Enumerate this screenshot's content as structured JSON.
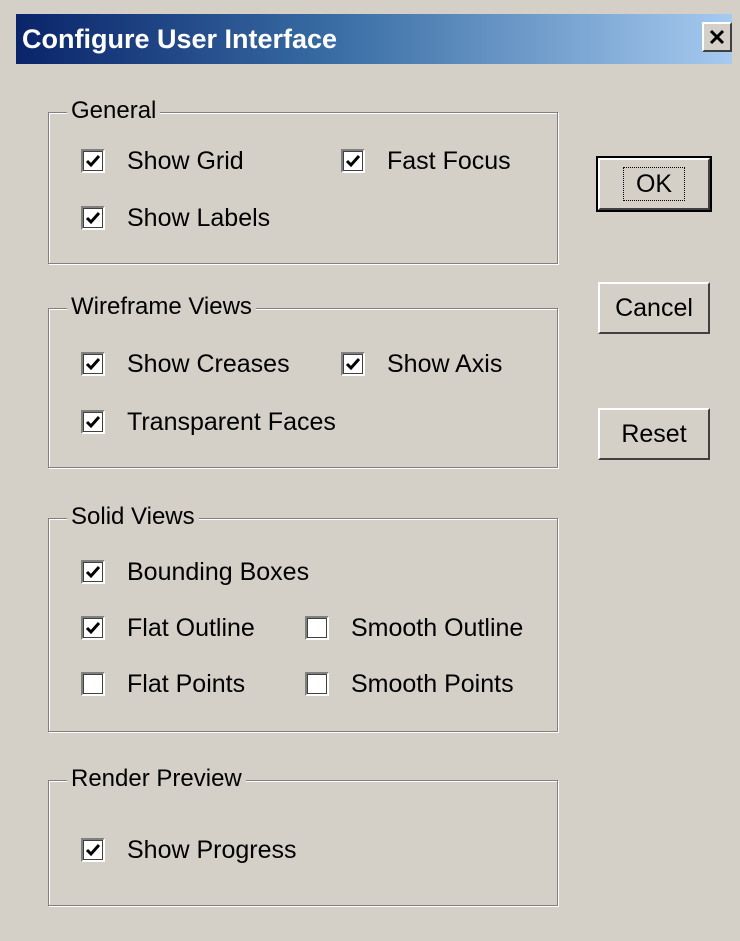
{
  "window": {
    "title": "Configure User Interface",
    "close_label": "close"
  },
  "groups": {
    "general": {
      "legend": "General",
      "show_grid": {
        "label": "Show Grid",
        "checked": true
      },
      "fast_focus": {
        "label": "Fast Focus",
        "checked": true
      },
      "show_labels": {
        "label": "Show Labels",
        "checked": true
      }
    },
    "wireframe": {
      "legend": "Wireframe Views",
      "show_creases": {
        "label": "Show Creases",
        "checked": true
      },
      "show_axis": {
        "label": "Show Axis",
        "checked": true
      },
      "transparent_faces": {
        "label": "Transparent Faces",
        "checked": true
      }
    },
    "solid": {
      "legend": "Solid Views",
      "bounding_boxes": {
        "label": "Bounding Boxes",
        "checked": true
      },
      "flat_outline": {
        "label": "Flat Outline",
        "checked": true
      },
      "smooth_outline": {
        "label": "Smooth Outline",
        "checked": false
      },
      "flat_points": {
        "label": "Flat Points",
        "checked": false
      },
      "smooth_points": {
        "label": "Smooth Points",
        "checked": false
      }
    },
    "render": {
      "legend": "Render Preview",
      "show_progress": {
        "label": "Show Progress",
        "checked": true
      }
    }
  },
  "buttons": {
    "ok": "OK",
    "cancel": "Cancel",
    "reset": "Reset"
  },
  "colors": {
    "title_gradient_start": "#0a246a",
    "title_gradient_end": "#a6caf0",
    "dialog_face": "#d4d0c8"
  }
}
